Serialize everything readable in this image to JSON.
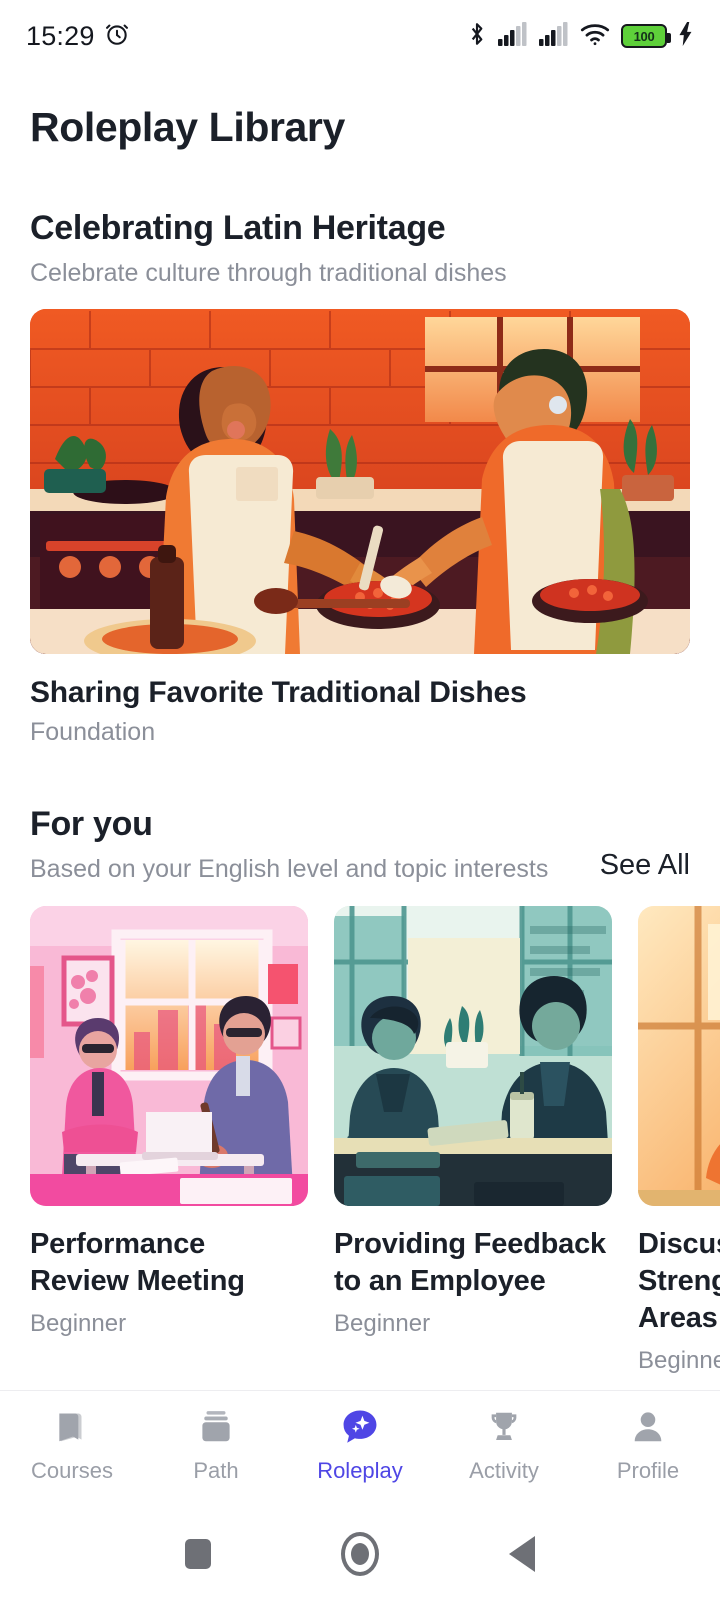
{
  "status_bar": {
    "time": "15:29",
    "alarm_icon": "alarm-clock-icon",
    "bluetooth_icon": "bluetooth-icon",
    "signal_icon_1": "cellular-signal-icon",
    "signal_icon_2": "cellular-signal-icon",
    "wifi_icon": "wifi-icon",
    "battery_level": "100",
    "battery_charging_icon": "charging-bolt-icon",
    "battery_color": "#5ed03a"
  },
  "header": {
    "title": "Roleplay Library"
  },
  "featured": {
    "section_title": "Celebrating Latin Heritage",
    "section_subtitle": "Celebrate culture through traditional dishes",
    "image_alt": "two-women-cooking-illustration",
    "card_title": "Sharing Favorite Traditional Dishes",
    "card_level": "Foundation"
  },
  "for_you": {
    "section_title": "For you",
    "section_subtitle": "Based on your English level and topic interests",
    "see_all_label": "See All",
    "cards": [
      {
        "title": "Performance Review Meeting",
        "level": "Beginner",
        "image_alt": "pink-office-meeting-illustration",
        "theme_color": "#f27ab5"
      },
      {
        "title": "Providing Feedback to an Employee",
        "level": "Beginner",
        "image_alt": "teal-office-conversation-illustration",
        "theme_color": "#3d8f8a"
      },
      {
        "title": "Discussing Strengths and Areas",
        "level": "Beginner",
        "image_alt": "orange-presentation-illustration",
        "theme_color": "#f59440"
      }
    ]
  },
  "tab_bar": {
    "active_color": "#4f46e5",
    "inactive_color": "#9a9ea7",
    "tabs": [
      {
        "label": "Courses",
        "icon": "book-icon",
        "active": false
      },
      {
        "label": "Path",
        "icon": "layers-stack-icon",
        "active": false
      },
      {
        "label": "Roleplay",
        "icon": "chat-sparkle-icon",
        "active": true
      },
      {
        "label": "Activity",
        "icon": "trophy-icon",
        "active": false
      },
      {
        "label": "Profile",
        "icon": "person-icon",
        "active": false
      }
    ]
  },
  "system_nav": {
    "recents_icon": "square-recents-icon",
    "home_icon": "circle-home-icon",
    "back_icon": "triangle-back-icon"
  }
}
